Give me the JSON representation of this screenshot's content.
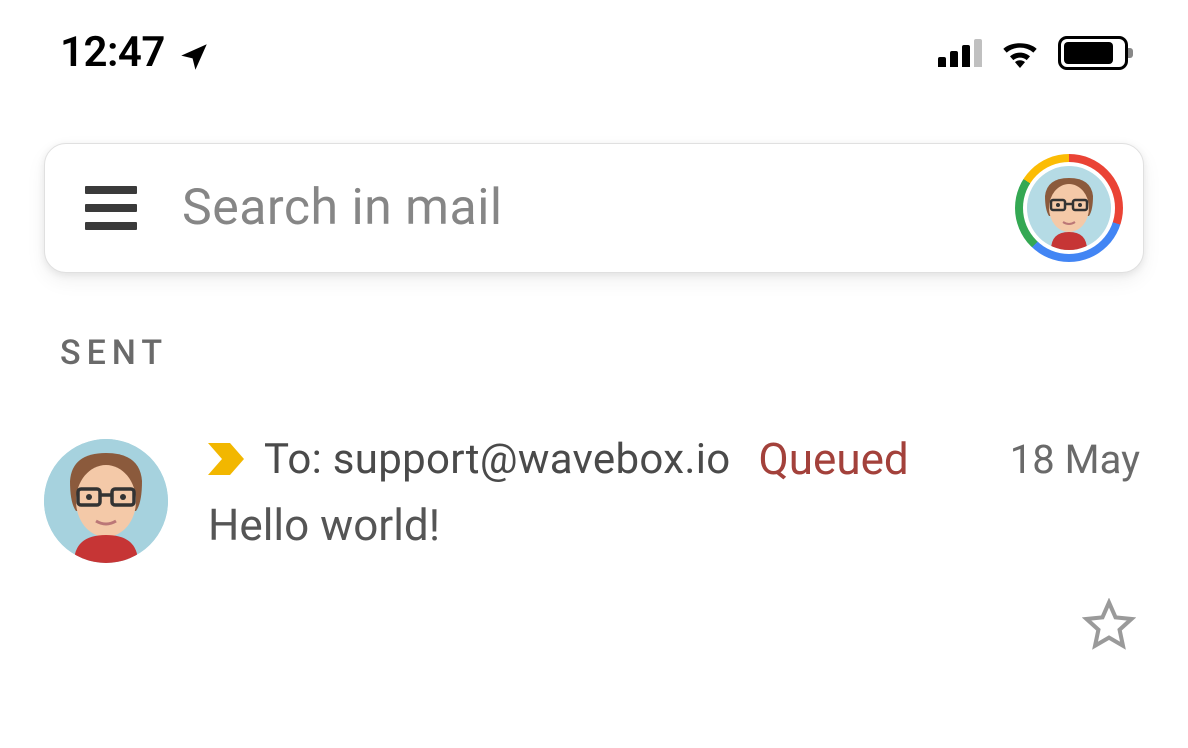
{
  "status": {
    "time": "12:47"
  },
  "search": {
    "placeholder": "Search in mail"
  },
  "folder": {
    "label": "SENT"
  },
  "emails": [
    {
      "to_prefix": "To:",
      "to_address": "support@wavebox.io",
      "status": "Queued",
      "date": "18 May",
      "subject": "Hello world!"
    }
  ]
}
